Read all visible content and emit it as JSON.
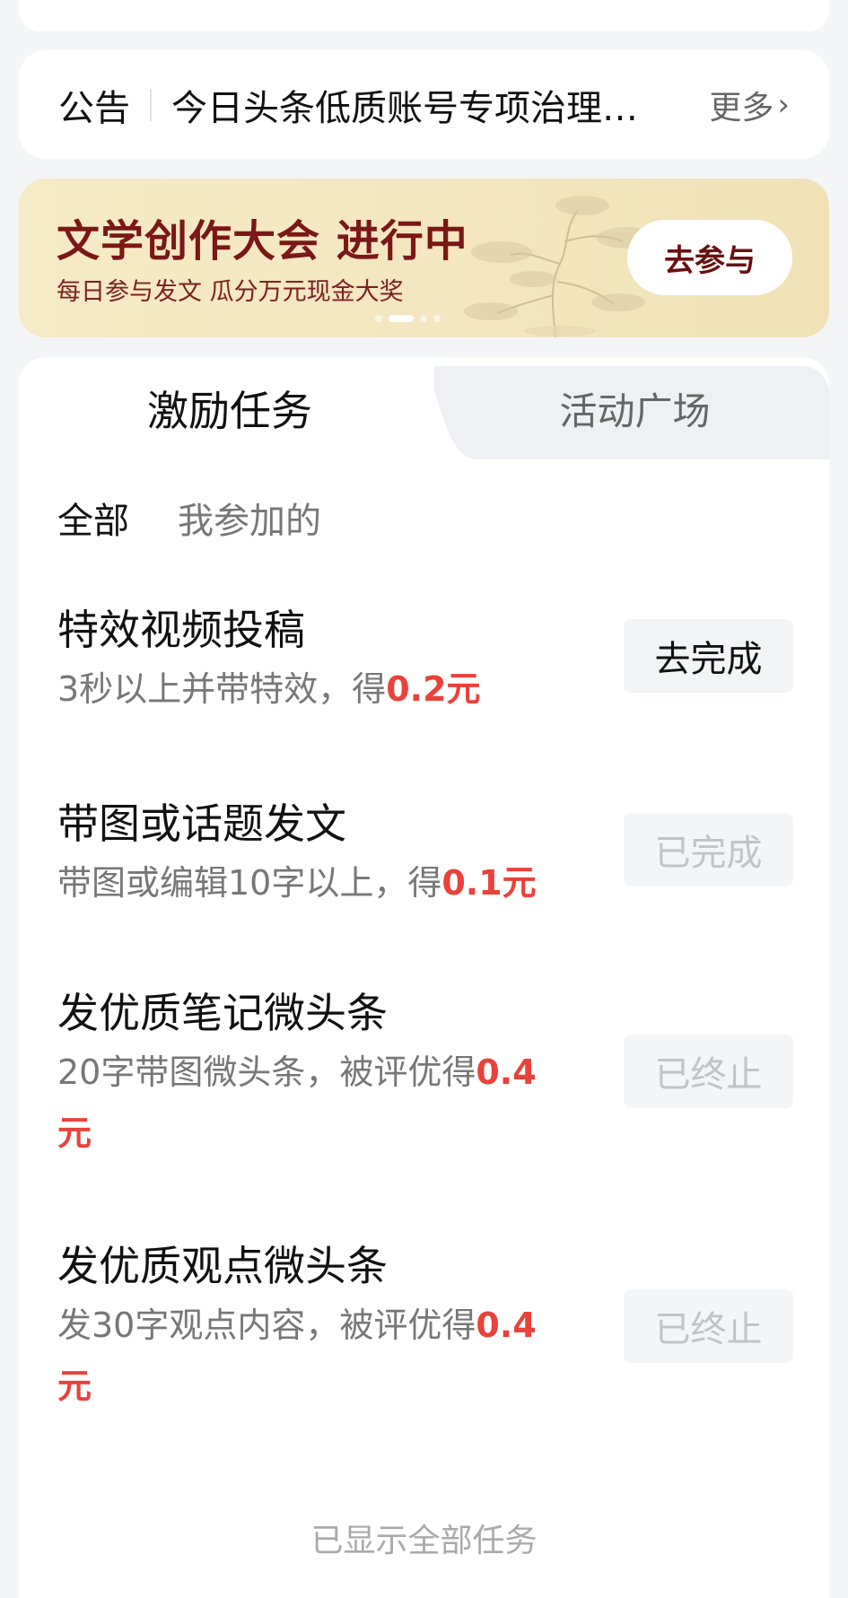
{
  "notice": {
    "label": "公告",
    "text": "今日头条低质账号专项治理…",
    "more": "更多",
    "chevron": "›"
  },
  "banner": {
    "title": "文学创作大会 进行中",
    "subtitle": "每日参与发文 瓜分万元现金大奖",
    "button": "去参与",
    "carousel": {
      "count": 4,
      "active_index": 1
    }
  },
  "tabs": [
    {
      "label": "激励任务",
      "active": true
    },
    {
      "label": "活动广场",
      "active": false
    }
  ],
  "filters": [
    {
      "label": "全部",
      "active": true
    },
    {
      "label": "我参加的",
      "active": false
    }
  ],
  "tasks": [
    {
      "title": "特效视频投稿",
      "desc": "3秒以上并带特效，得",
      "reward": "0.2元",
      "button": "去完成",
      "state": "available"
    },
    {
      "title": "带图或话题发文",
      "desc": "带图或编辑10字以上，得",
      "reward": "0.1元",
      "button": "已完成",
      "state": "done"
    },
    {
      "title": "发优质笔记微头条",
      "desc": "20字带图微头条，被评优得",
      "reward": "0.4元",
      "button": "已终止",
      "state": "ended"
    },
    {
      "title": "发优质观点微头条",
      "desc": "发30字观点内容，被评优得",
      "reward": "0.4元",
      "button": "已终止",
      "state": "ended"
    }
  ],
  "footer": "已显示全部任务",
  "colors": {
    "reward": "#e8423a",
    "banner_title": "#7b1717",
    "background": "#f4f5f7"
  }
}
